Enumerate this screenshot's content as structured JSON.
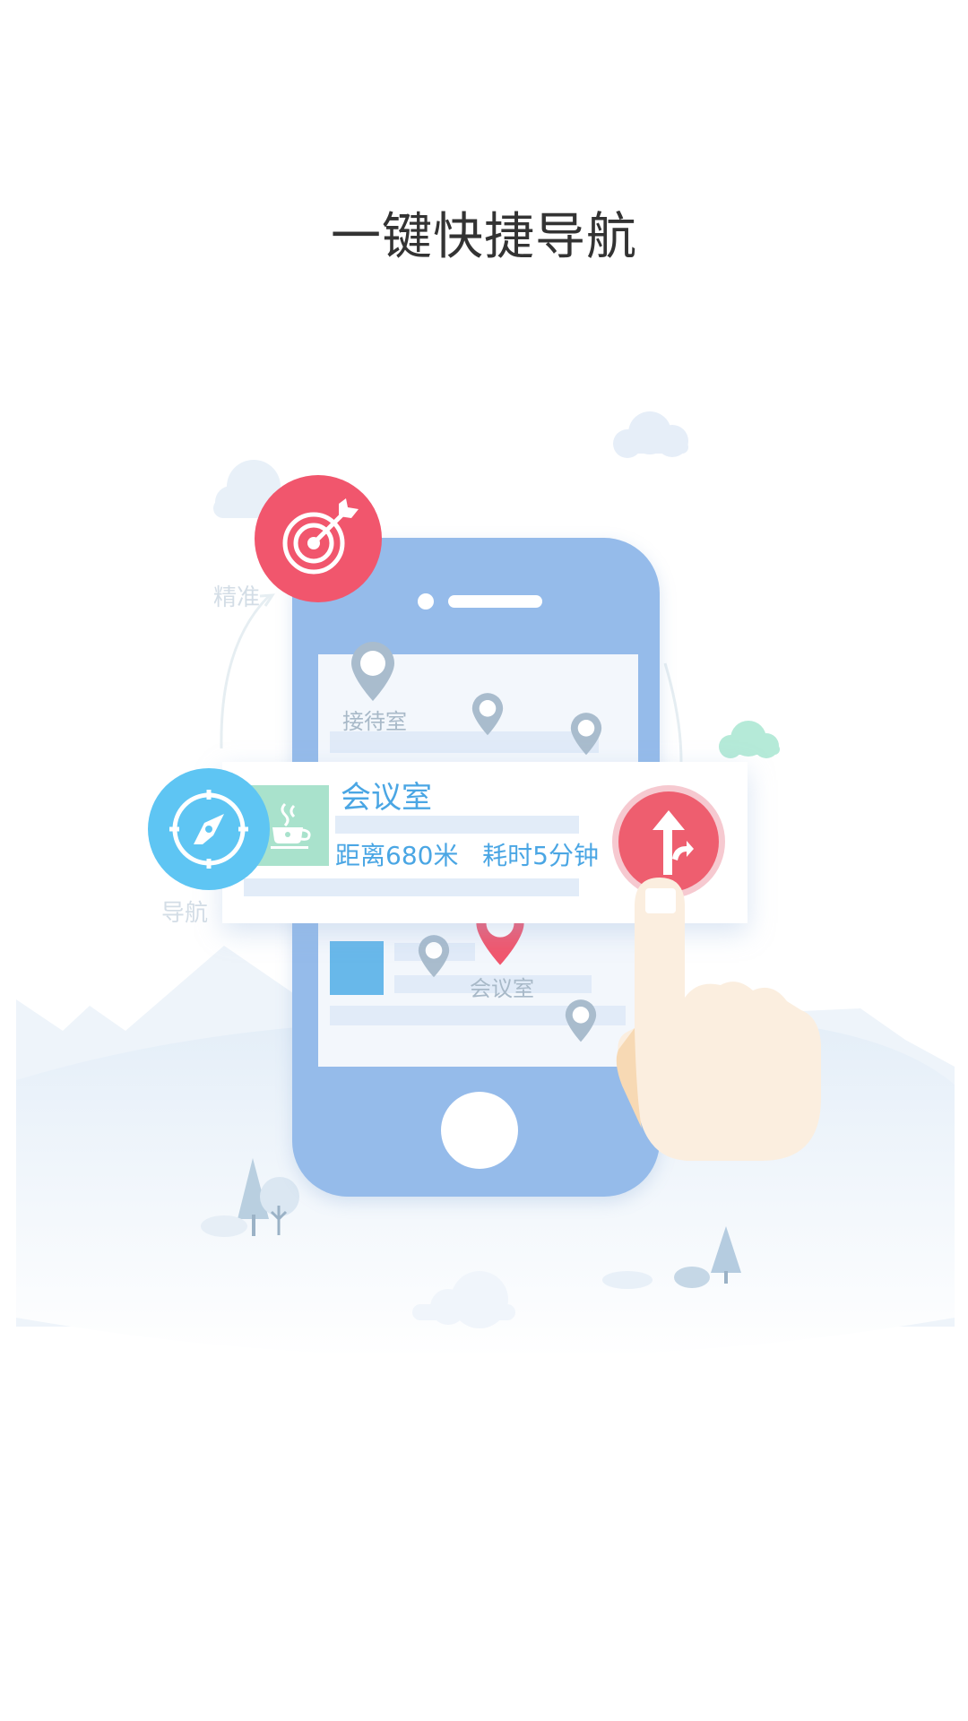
{
  "headline": "一键快捷导航",
  "illustration": {
    "feature_labels": {
      "precise": "精准",
      "navigation": "导航"
    },
    "map_pins": {
      "reception": "接待室",
      "meeting_room": "会议室"
    },
    "info_card": {
      "title": "会议室",
      "distance": "距离680米",
      "duration": "耗时5分钟"
    },
    "icons": {
      "precise": "target-arrow-icon",
      "navigation": "compass-icon",
      "route": "route-arrow-icon",
      "place": "coffee-cup-icon",
      "pin": "map-pin-icon"
    },
    "colors": {
      "accent_red": "#f1566d",
      "accent_blue": "#5ec5f3",
      "phone_blue": "#95bbea",
      "text_blue": "#4aa6e4",
      "mint": "#a9e2cc"
    }
  }
}
